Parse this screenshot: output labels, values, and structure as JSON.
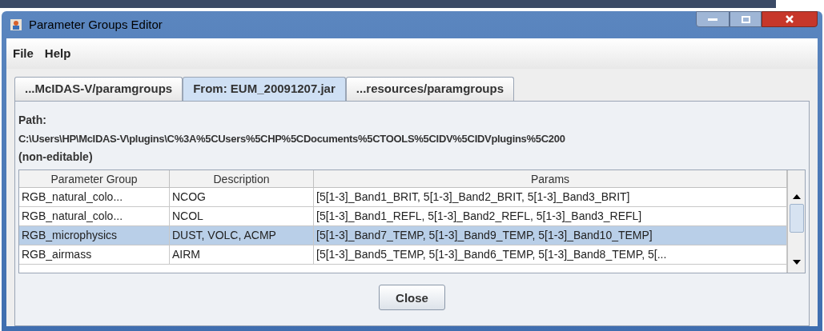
{
  "window": {
    "title": "Parameter Groups Editor"
  },
  "menu": [
    "File",
    "Help"
  ],
  "tabs": [
    {
      "label": "...McIDAS-V/paramgroups",
      "selected": false
    },
    {
      "label": "From: EUM_20091207.jar",
      "selected": true
    },
    {
      "label": "...resources/paramgroups",
      "selected": false
    }
  ],
  "path": {
    "label": "Path:",
    "value": "C:\\Users\\HP\\McIDAS-V\\plugins\\C%3A%5CUsers%5CHP%5CDocuments%5CTOOLS%5CIDV%5CIDVplugins%5C200",
    "note": "(non-editable)"
  },
  "table": {
    "columns": [
      "Parameter Group",
      "Description",
      "Params"
    ],
    "rows": [
      {
        "cells": [
          "RGB_natural_colo...",
          "NCOG",
          "[5[1-3]_Band1_BRIT, 5[1-3]_Band2_BRIT, 5[1-3]_Band3_BRIT]"
        ],
        "selected": false
      },
      {
        "cells": [
          "RGB_natural_colo...",
          "NCOL",
          "[5[1-3]_Band1_REFL, 5[1-3]_Band2_REFL, 5[1-3]_Band3_REFL]"
        ],
        "selected": false
      },
      {
        "cells": [
          "RGB_microphysics",
          "DUST, VOLC, ACMP",
          "[5[1-3]_Band7_TEMP, 5[1-3]_Band9_TEMP, 5[1-3]_Band10_TEMP]"
        ],
        "selected": true
      },
      {
        "cells": [
          "RGB_airmass",
          "AIRM",
          "[5[1-3]_Band5_TEMP, 5[1-3]_Band6_TEMP, 5[1-3]_Band8_TEMP, 5[..."
        ],
        "selected": false
      }
    ]
  },
  "buttons": [
    "Close"
  ]
}
